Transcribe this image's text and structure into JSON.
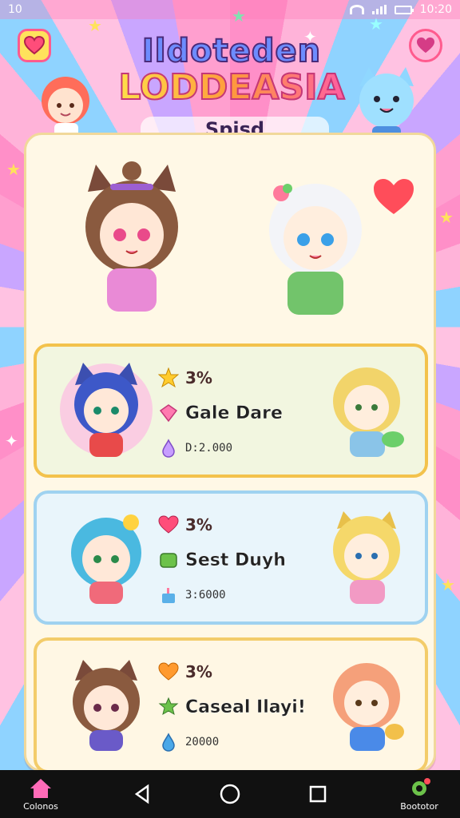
{
  "status_bar": {
    "left_text": "10",
    "time": "10:20"
  },
  "header": {
    "title_line1": "Ildoteden",
    "title_line2": "LODDEASIA",
    "subtitle": "Spisd Iopkannia!"
  },
  "cards": [
    {
      "percent": "3%",
      "name": "Gale Dare",
      "score": "D:2.000",
      "colors": {
        "bg": "#f2f6e0",
        "border": "#f3c24c"
      }
    },
    {
      "percent": "3%",
      "name": "Sest Duyh",
      "score": "3:6000",
      "colors": {
        "bg": "#e9f5fb",
        "border": "#9fd2f0"
      }
    },
    {
      "percent": "3%",
      "name": "Caseal Ilayi!",
      "score": "20000",
      "colors": {
        "bg": "#fff7e4",
        "border": "#f3cc6a"
      }
    }
  ],
  "nav": {
    "left_tab_label": "Colonos",
    "right_tab_label": "Boototor"
  },
  "icons": {
    "top_left": "heart-icon",
    "top_right": "heart-badge-icon",
    "card_1_row_a": "star-icon",
    "card_1_row_b": "gem-icon",
    "card_1_row_c": "potion-icon",
    "card_2_row_a": "heart-icon",
    "card_2_row_b": "box-icon",
    "card_2_row_c": "cake-icon",
    "card_3_row_a": "heart-icon",
    "card_3_row_b": "star-bag-icon",
    "card_3_row_c": "drop-icon"
  }
}
